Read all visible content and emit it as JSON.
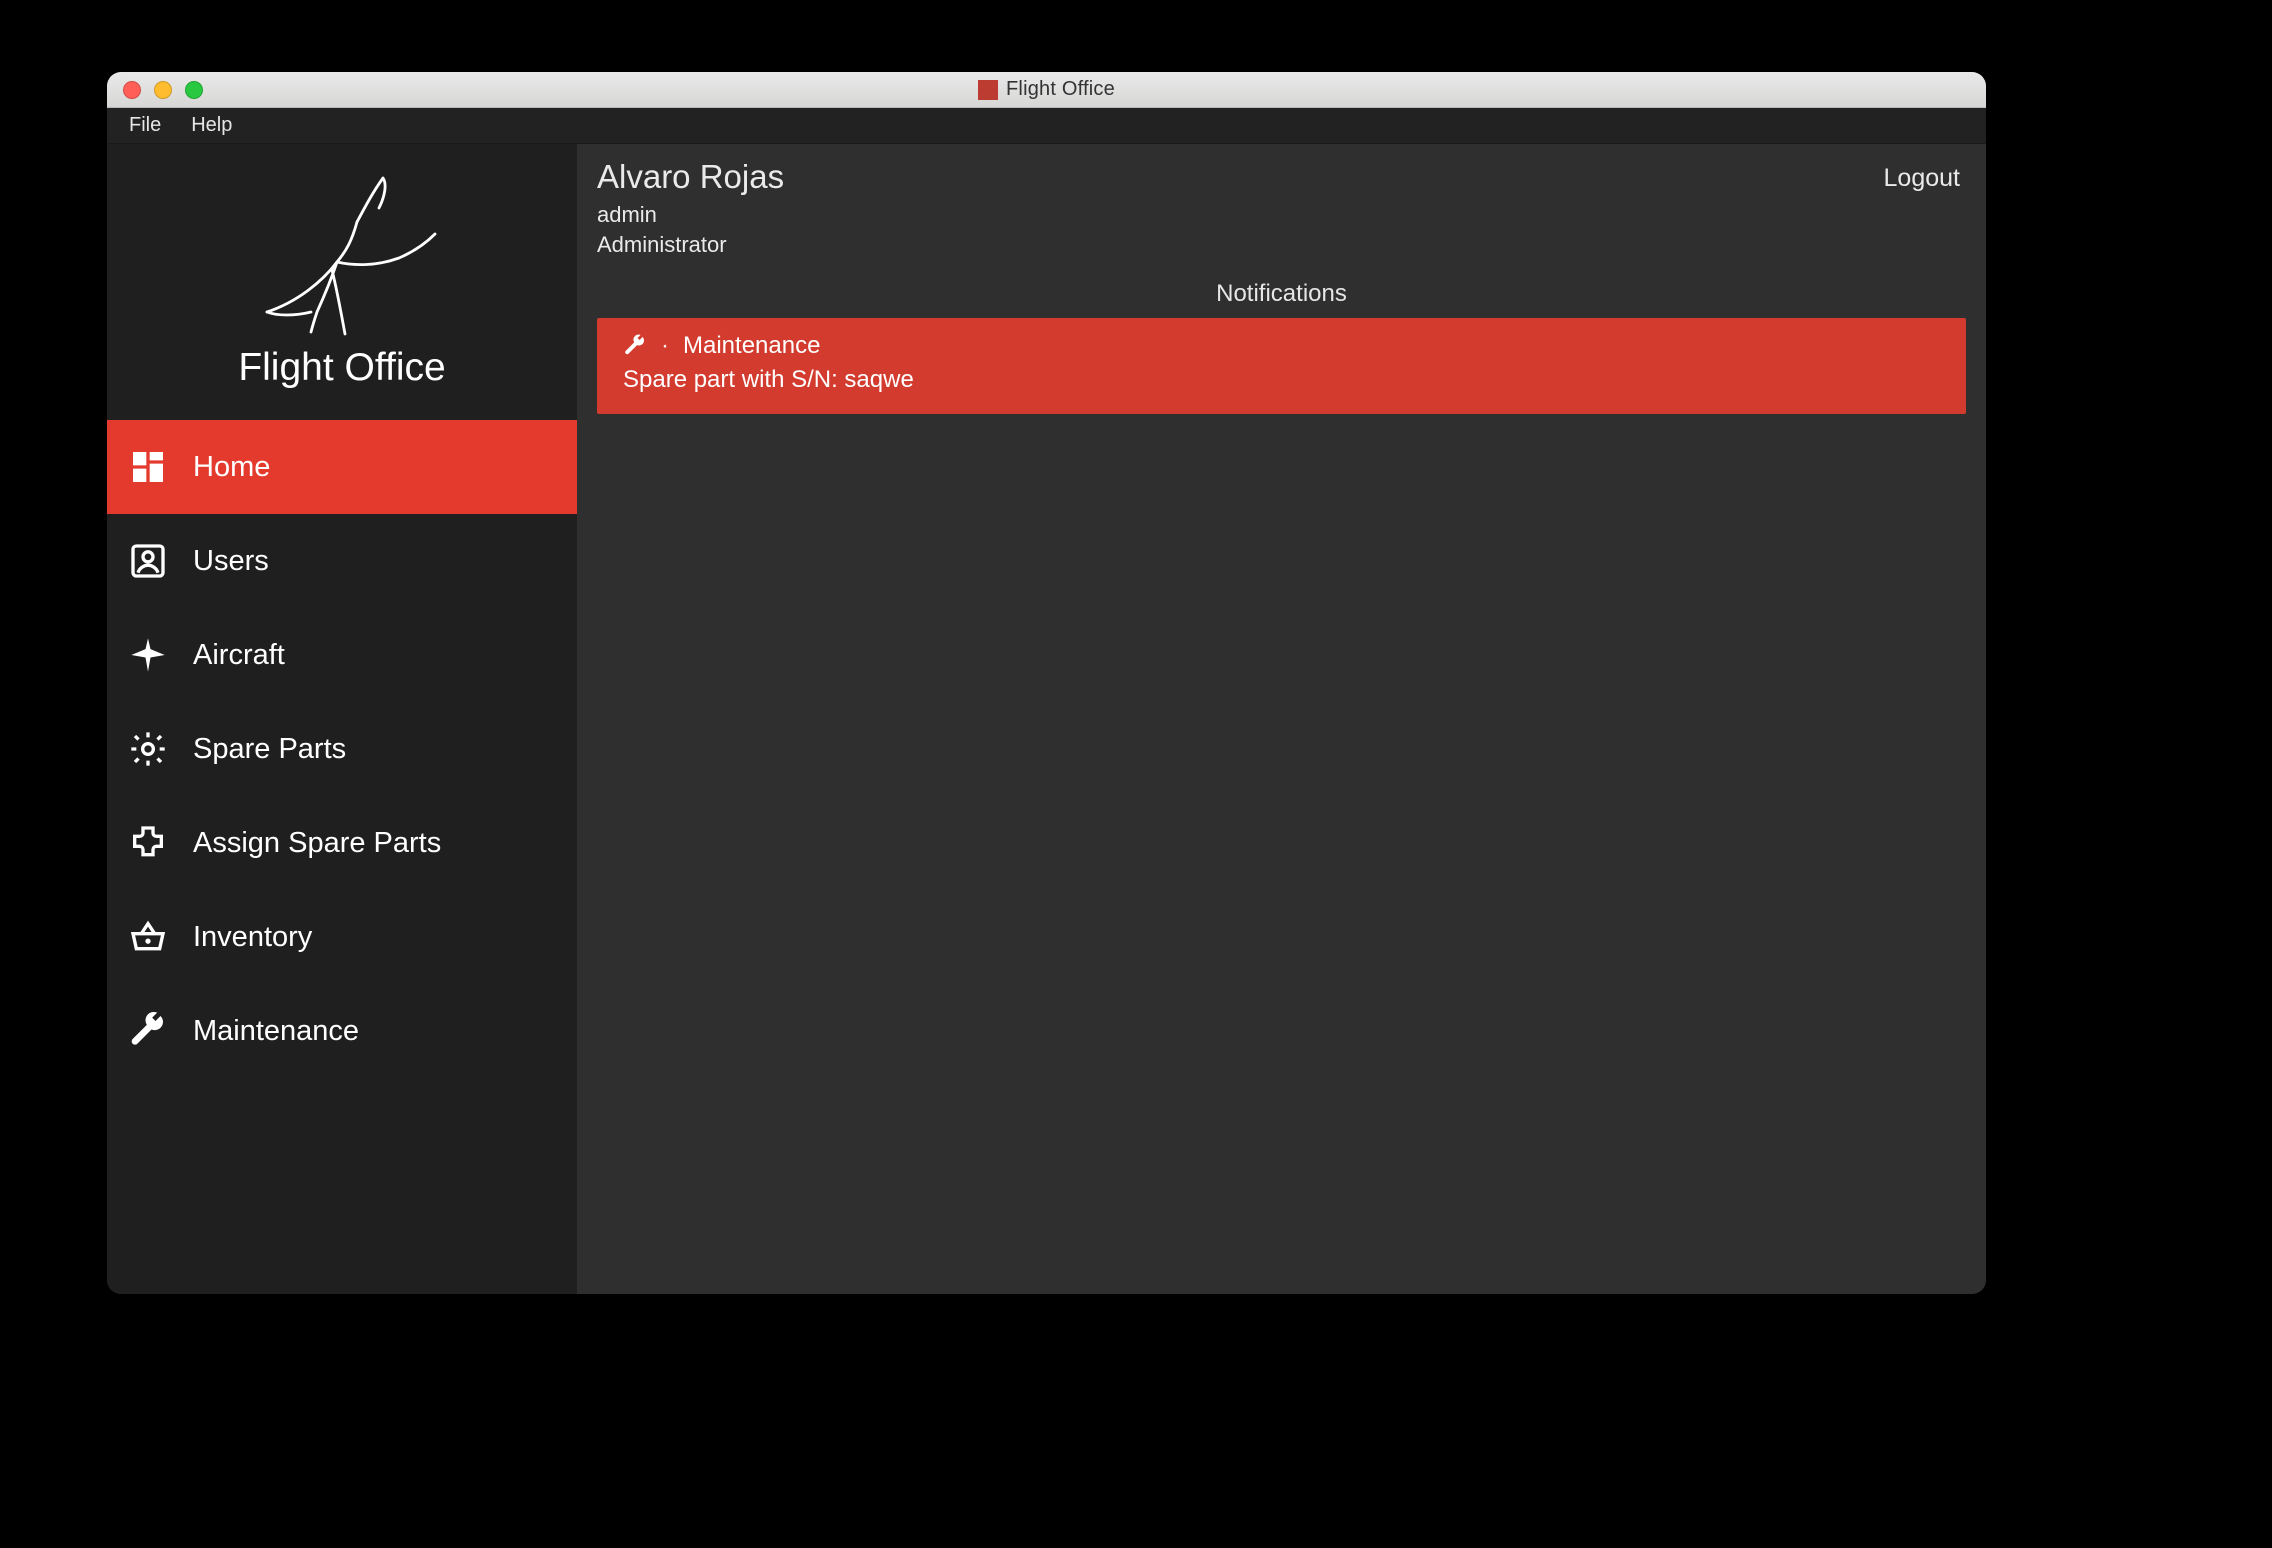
{
  "window": {
    "title": "Flight Office"
  },
  "menubar": {
    "file": "File",
    "help": "Help"
  },
  "brand": "Flight Office",
  "sidebar": {
    "items": [
      {
        "key": "home",
        "label": "Home",
        "active": true
      },
      {
        "key": "users",
        "label": "Users"
      },
      {
        "key": "aircraft",
        "label": "Aircraft"
      },
      {
        "key": "spare-parts",
        "label": "Spare Parts"
      },
      {
        "key": "assign-spare-parts",
        "label": "Assign Spare Parts"
      },
      {
        "key": "inventory",
        "label": "Inventory"
      },
      {
        "key": "maintenance",
        "label": "Maintenance"
      }
    ]
  },
  "header": {
    "user_name": "Alvaro Rojas",
    "username": "admin",
    "role": "Administrator",
    "logout": "Logout"
  },
  "notifications": {
    "title": "Notifications",
    "items": [
      {
        "category": "Maintenance",
        "message": "Spare part with S/N: saqwe",
        "severity_color": "#d23b2e"
      }
    ]
  },
  "colors": {
    "accent": "#e43a2e",
    "notif": "#d23b2e",
    "sidebar_bg": "#1f1f1f",
    "main_bg": "#2f2f2f"
  }
}
